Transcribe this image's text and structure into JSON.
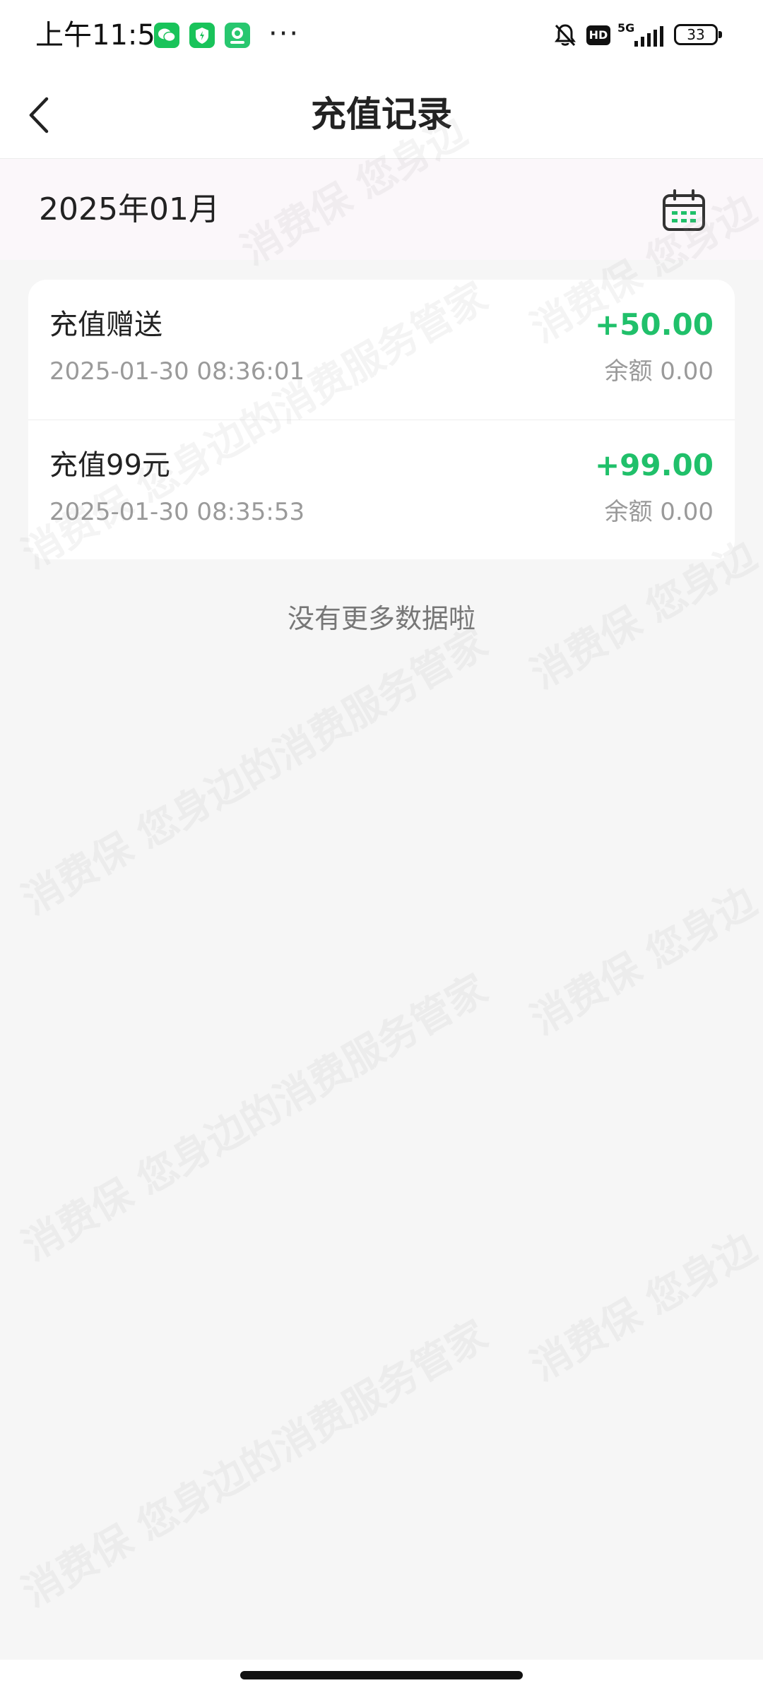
{
  "status_bar": {
    "time": "上午11:53",
    "dots": "···",
    "hd": "HD",
    "network": "5G",
    "battery": "33"
  },
  "header": {
    "title": "充值记录",
    "back_icon": "chevron-left-icon"
  },
  "month_bar": {
    "month": "2025年01月",
    "calendar_icon": "calendar-icon",
    "accent_color": "#20c06a"
  },
  "records": [
    {
      "title": "充值赠送",
      "time": "2025-01-30 08:36:01",
      "amount": "+50.00",
      "balance": "余额 0.00"
    },
    {
      "title": "充值99元",
      "time": "2025-01-30 08:35:53",
      "amount": "+99.00",
      "balance": "余额 0.00"
    }
  ],
  "footer": {
    "no_more": "没有更多数据啦"
  },
  "watermark": {
    "text_long": "消费保 您身边的消费服务管家",
    "text_short": "消费保 您身边"
  },
  "colors": {
    "amount": "#20c06a",
    "muted": "#9a9a9a",
    "month_bg": "#fbf7fa"
  }
}
